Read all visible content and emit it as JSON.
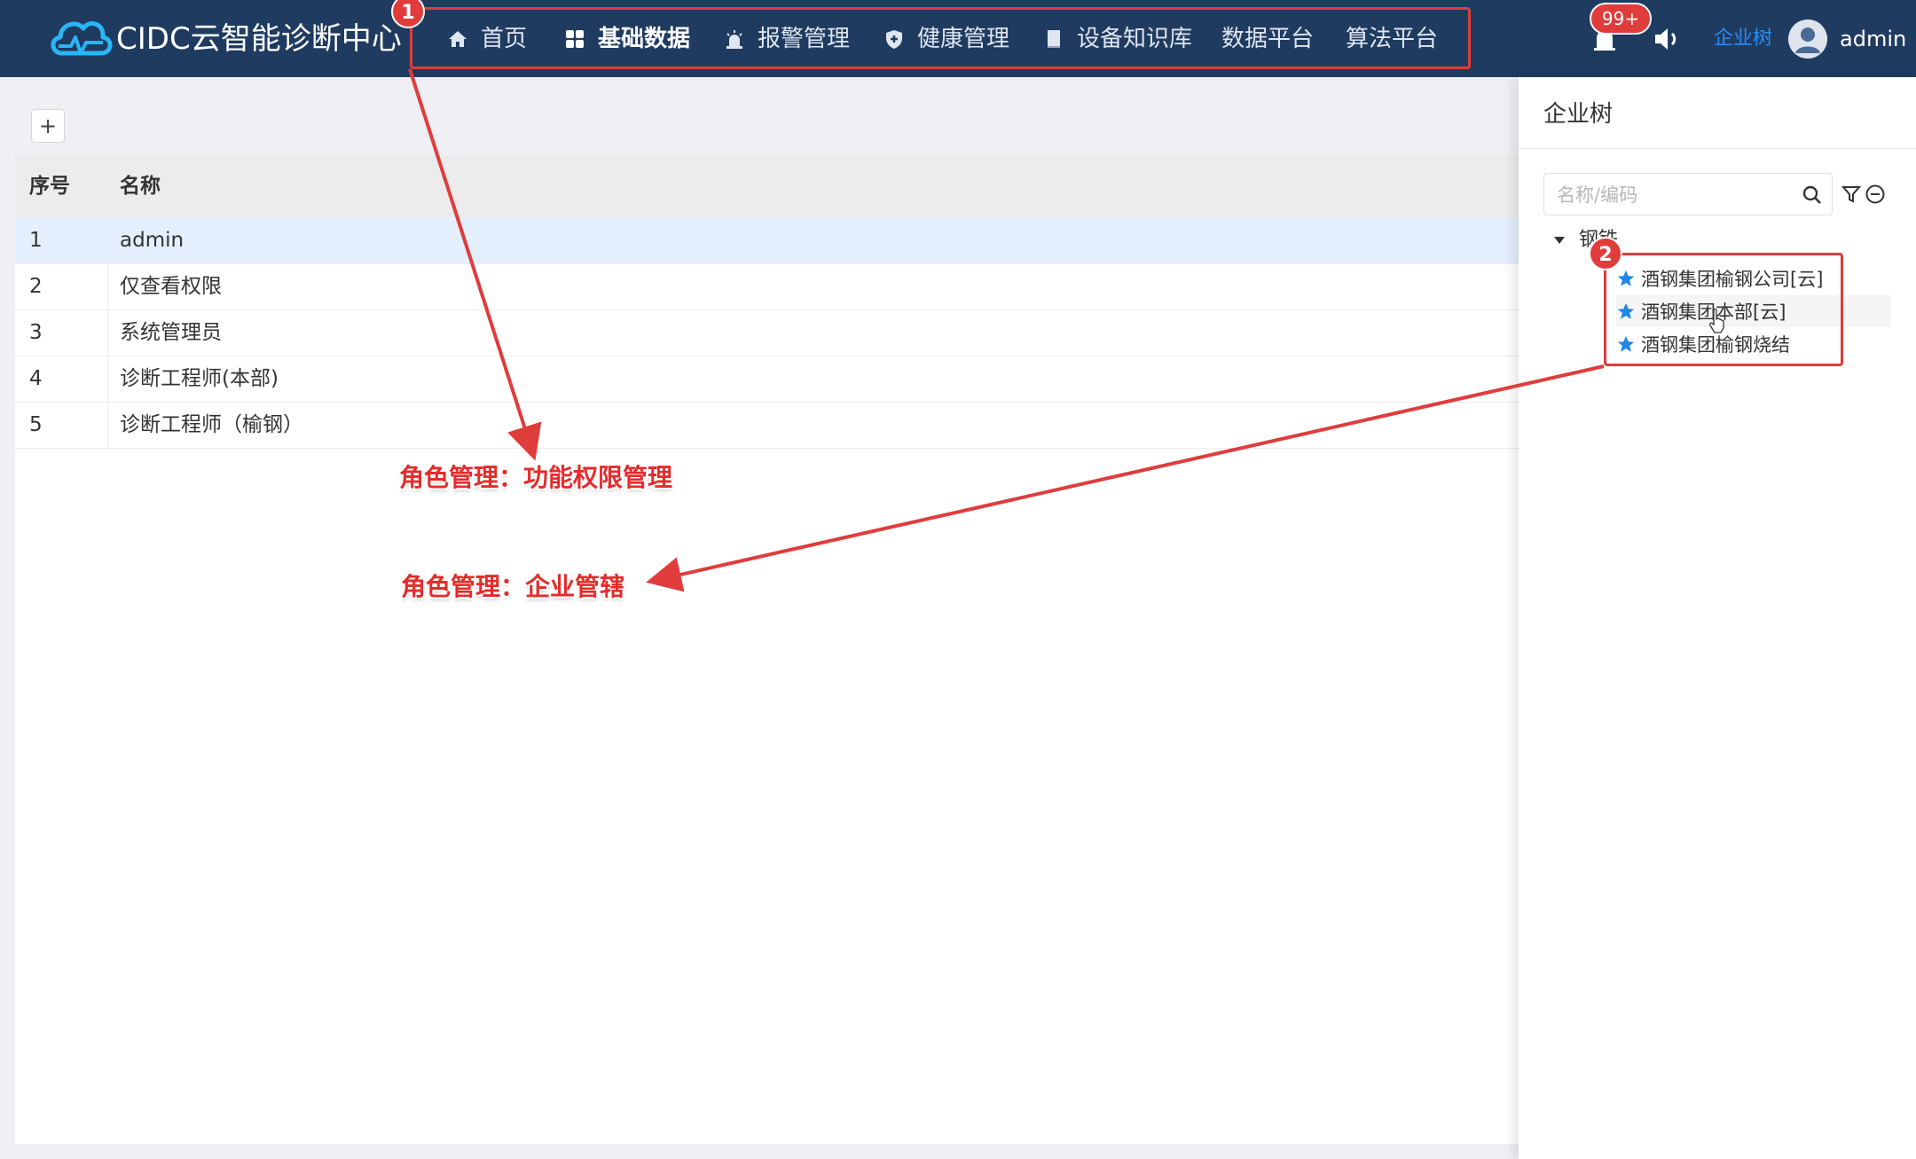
{
  "header": {
    "app_title": "CIDC云智能诊断中心",
    "nav": [
      {
        "label": "首页",
        "icon": "home-icon"
      },
      {
        "label": "基础数据",
        "icon": "grid-icon",
        "active": true
      },
      {
        "label": "报警管理",
        "icon": "alarm-icon"
      },
      {
        "label": "健康管理",
        "icon": "shield-icon"
      },
      {
        "label": "设备知识库",
        "icon": "book-icon"
      },
      {
        "label": "数据平台"
      },
      {
        "label": "算法平台"
      }
    ],
    "notification_count": "99+",
    "enterprise_tree_link": "企业树",
    "username": "admin"
  },
  "toolbar": {
    "add_label": "+"
  },
  "table": {
    "columns": [
      "序号",
      "名称"
    ],
    "rows": [
      {
        "index": "1",
        "name": "admin"
      },
      {
        "index": "2",
        "name": "仅查看权限"
      },
      {
        "index": "3",
        "name": "系统管理员"
      },
      {
        "index": "4",
        "name": "诊断工程师(本部)"
      },
      {
        "index": "5",
        "name": "诊断工程师（榆钢）"
      }
    ]
  },
  "annotations": {
    "badge_1": "1",
    "badge_2": "2",
    "text_1": "角色管理：功能权限管理",
    "text_2": "角色管理：企业管辖"
  },
  "panel": {
    "title": "企业树",
    "search_placeholder": "名称/编码",
    "tree_root": "钢铁",
    "tree_children": [
      "酒钢集团榆钢公司[云]",
      "酒钢集团本部[云]",
      "酒钢集团榆钢烧结"
    ]
  },
  "colors": {
    "header_bg": "#1f3b60",
    "accent": "#2d8cf0",
    "annotation_red": "#e03c3c",
    "selected_row": "#e4effd"
  }
}
